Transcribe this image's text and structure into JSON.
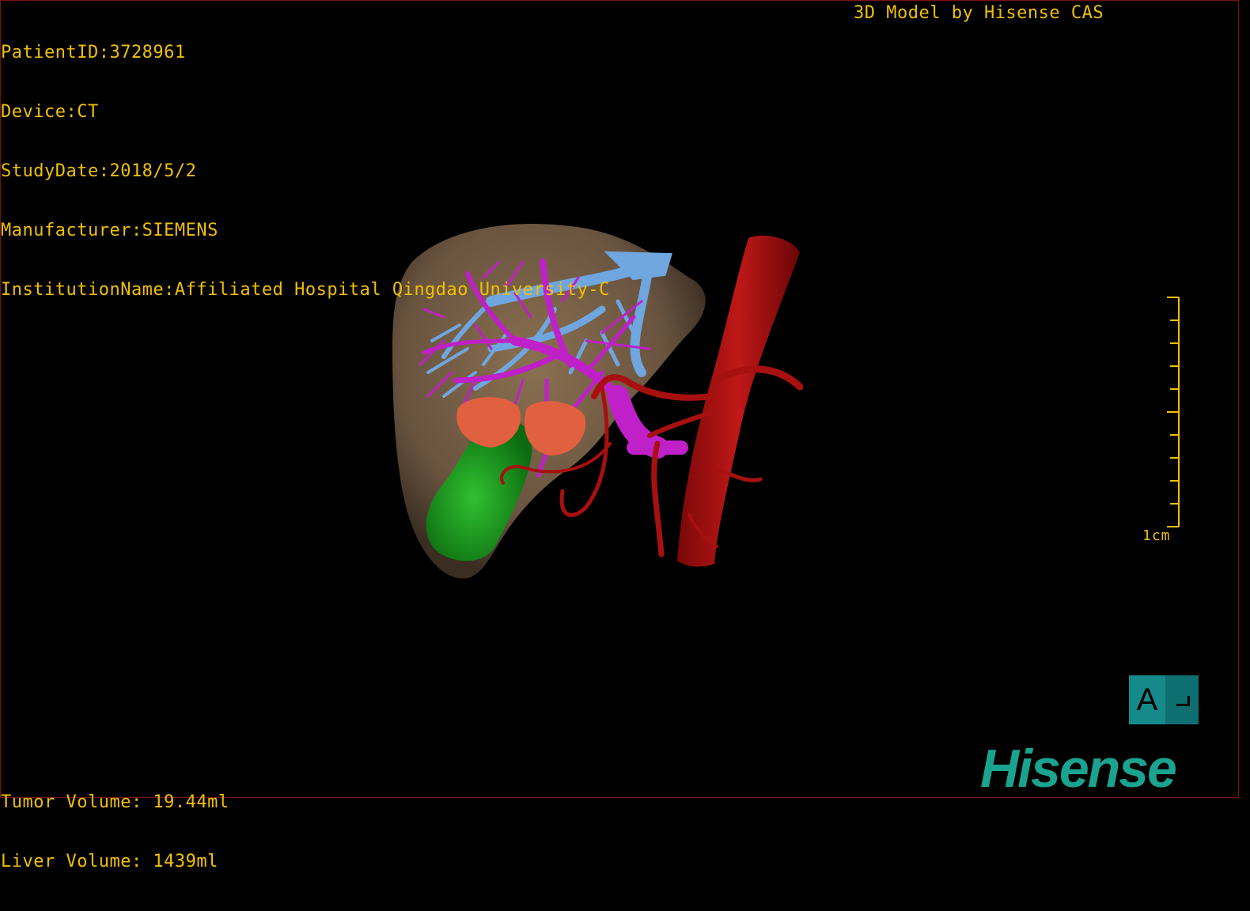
{
  "patient_info": {
    "patient_id": "PatientID:3728961",
    "device": "Device:CT",
    "study_date": "StudyDate:2018/5/2",
    "manufacturer": "Manufacturer:SIEMENS",
    "institution": "InstitutionName:Affiliated Hospital Qingdao University-C"
  },
  "credit": "3D Model by Hisense CAS",
  "volumes": {
    "tumor": "Tumor Volume: 19.44ml",
    "liver": "Liver Volume: 1439ml"
  },
  "scale_bar": {
    "label": "1cm"
  },
  "orientation": {
    "label": "A"
  },
  "brand": {
    "logo_text": "Hisense"
  },
  "colors": {
    "overlay_text": "#f0c000",
    "liver": "#7a6248",
    "hepatic_vein": "#6fa6e0",
    "portal_vein": "#c020c8",
    "artery_vena_cava": "#b01010",
    "tumor": "#e06040",
    "gallbladder": "#1a9a20",
    "brand": "#1aa38f",
    "orientation_cube": "#168a8a"
  }
}
